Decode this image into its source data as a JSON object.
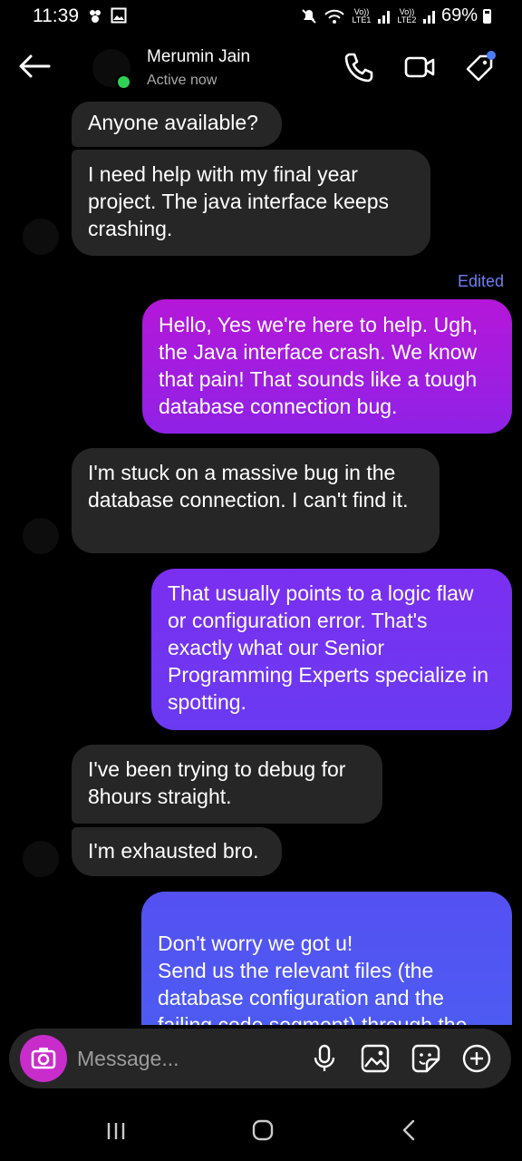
{
  "status_bar": {
    "time": "11:39",
    "sim1_label": "Vo)) LTE1",
    "sim2_label": "Vo)) LTE2",
    "battery": "69%"
  },
  "header": {
    "contact_name": "Merumin Jain",
    "status": "Active now",
    "presence_color": "#2fd055"
  },
  "messages": [
    {
      "direction": "incoming",
      "text": "Anyone available?"
    },
    {
      "direction": "incoming",
      "text": "I need help with my final year project. The java interface keeps crashing."
    },
    {
      "direction": "outgoing",
      "text": "Hello, Yes we're here to help. Ugh, the Java interface crash. We know that pain! That sounds like a tough database connection bug.",
      "edited_label": "Edited"
    },
    {
      "direction": "incoming",
      "text": "I'm stuck on a massive bug in the database connection. I can't find it."
    },
    {
      "direction": "outgoing",
      "text": "That usually points to a logic flaw or configuration error. That's exactly what our Senior Programming Experts specialize in spotting."
    },
    {
      "direction": "incoming",
      "text": "I've been trying to debug for 8hours straight."
    },
    {
      "direction": "incoming",
      "text": "I'm exhausted bro."
    },
    {
      "direction": "outgoing",
      "text": "Don't worry we got u!\nSend us the relevant files (the database configuration and the failing code segment) through the secure link in our bio"
    }
  ],
  "composer": {
    "placeholder": "Message..."
  },
  "icons": [
    "back-arrow-icon",
    "phone-icon",
    "video-icon",
    "tag-icon",
    "camera-icon",
    "microphone-icon",
    "gallery-icon",
    "sticker-icon",
    "plus-icon",
    "recents-icon",
    "home-icon",
    "back-nav-icon"
  ],
  "colors": {
    "incoming_bubble": "#262626",
    "outgoing_gradient_top": "#b016d6",
    "outgoing_gradient_bottom": "#4f5cf2",
    "camera_button": "#c82ccb",
    "edited_label": "#6f7ef2"
  }
}
